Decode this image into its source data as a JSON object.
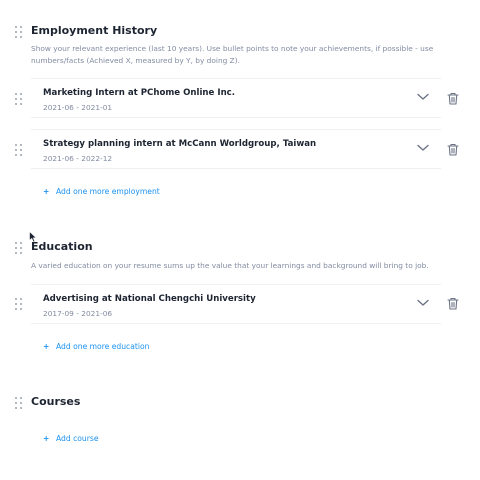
{
  "employment": {
    "title": "Employment History",
    "description": "Show your relevant experience (last 10 years). Use bullet points to note your achievements, if possible - use numbers/facts (Achieved X, measured by Y, by doing Z).",
    "items": [
      {
        "title": "Marketing Intern at PChome Online Inc.",
        "dates": "2021-06 - 2021-01"
      },
      {
        "title": "Strategy planning intern at McCann Worldgroup, Taiwan",
        "dates": "2021-06 - 2022-12"
      }
    ],
    "add_label": "Add one more employment"
  },
  "education": {
    "title": "Education",
    "description": "A varied education on your resume sums up the value that your learnings and background will bring to job.",
    "items": [
      {
        "title": "Advertising at National Chengchi University",
        "dates": "2017-09 - 2021-06"
      }
    ],
    "add_label": "Add one more education"
  },
  "courses": {
    "title": "Courses",
    "add_label": "Add course"
  },
  "icons": {
    "drag": "drag-handle-icon",
    "chevron": "chevron-down-icon",
    "trash": "trash-icon",
    "plus": "plus-icon",
    "cursor": "mouse-pointer-icon"
  },
  "colors": {
    "accent": "#1a91f0",
    "text": "#1e2532",
    "muted": "#828ba2",
    "divider": "#eef0f4"
  }
}
